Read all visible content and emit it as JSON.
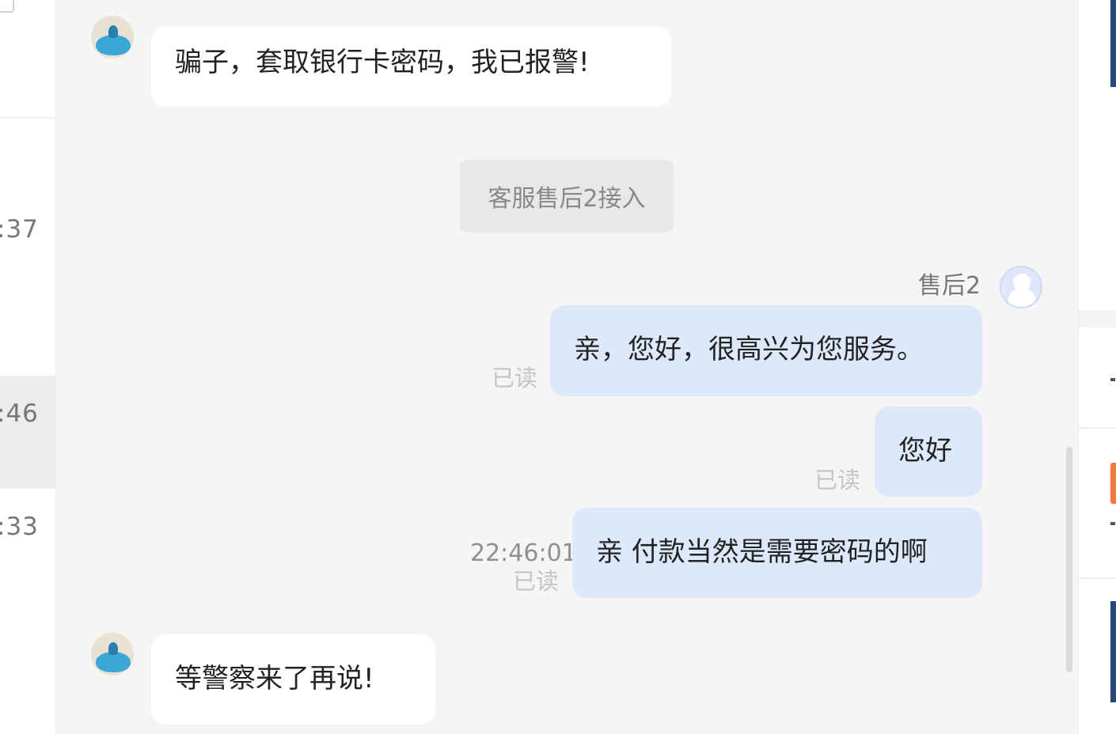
{
  "conversation_list": {
    "times": [
      ":37",
      ":46",
      ":33"
    ]
  },
  "chat": {
    "messages": [
      {
        "direction": "incoming",
        "text": "骗子，套取银行卡密码，我已报警!"
      },
      {
        "type": "system",
        "text": "客服售后2接入"
      },
      {
        "direction": "outgoing",
        "sender": "售后2",
        "text": "亲，您好，很高兴为您服务。",
        "status": "已读"
      },
      {
        "direction": "outgoing",
        "text": "您好",
        "status": "已读"
      },
      {
        "direction": "outgoing",
        "text": "亲 付款当然是需要密码的啊",
        "time": "22:46:01",
        "status": "已读"
      },
      {
        "direction": "incoming",
        "text": "等警察来了再说!"
      }
    ]
  },
  "colors": {
    "outgoing_bubble": "#dde9fb",
    "incoming_bubble": "#ffffff",
    "chat_background": "#f5f5f5",
    "notice_background": "#e8e8e8"
  }
}
